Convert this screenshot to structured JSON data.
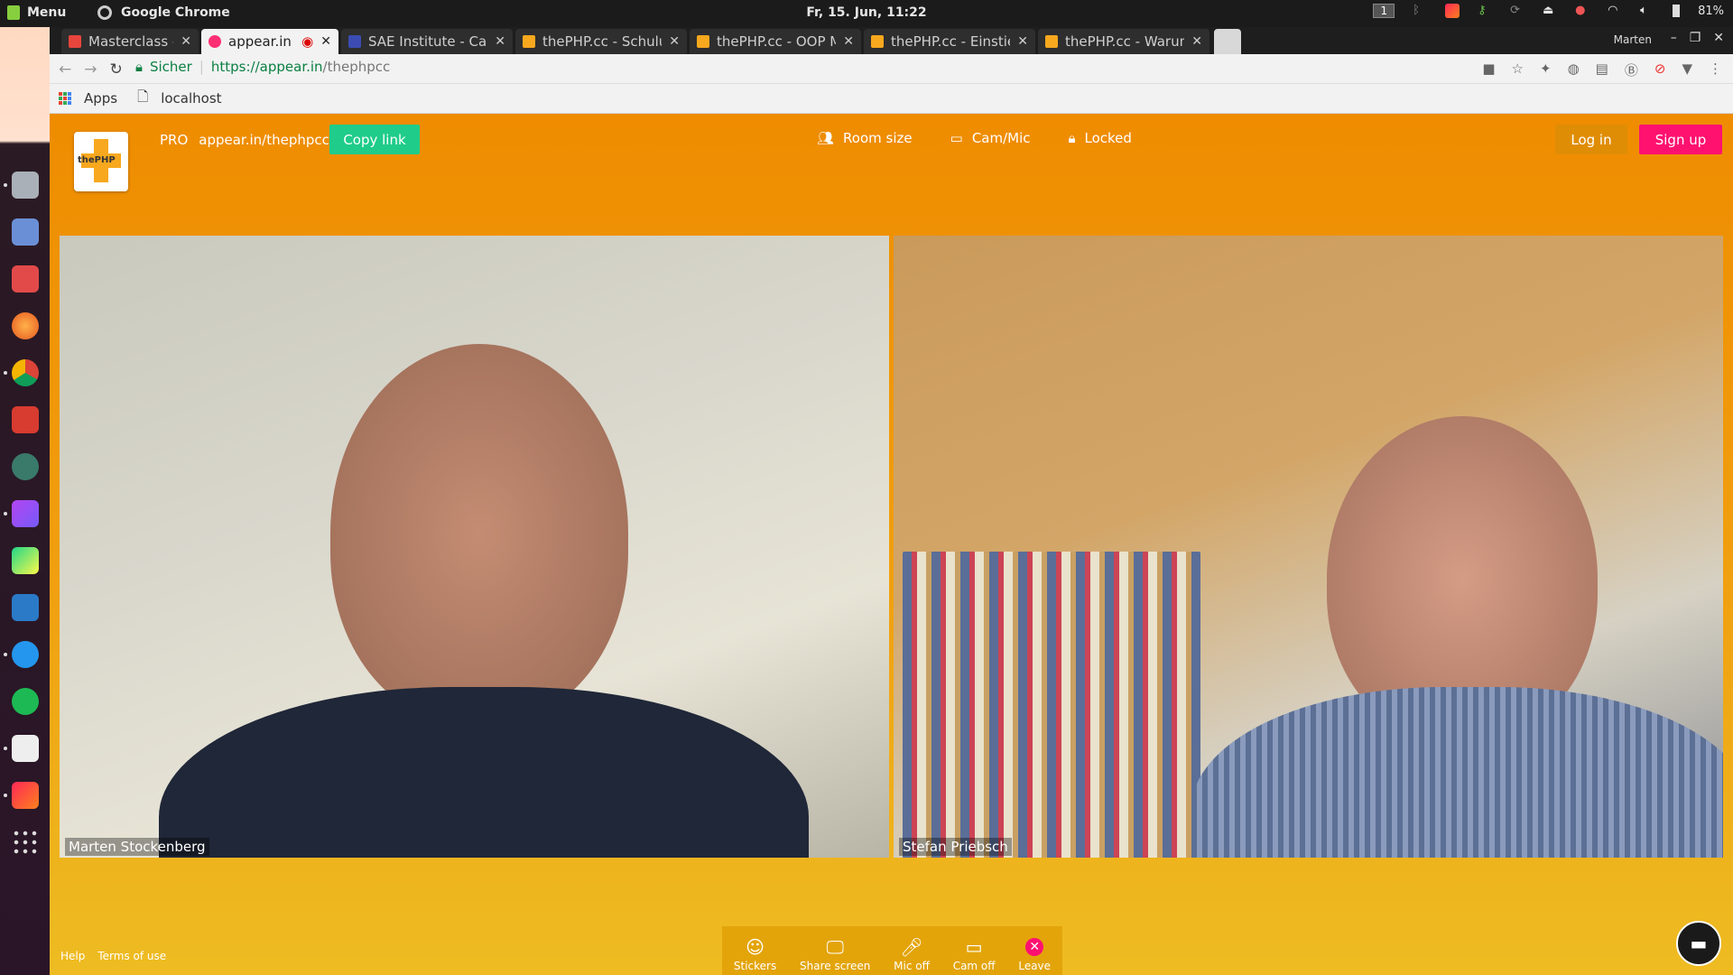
{
  "system": {
    "menu_label": "Menu",
    "app_name": "Google Chrome",
    "clock": "Fr, 15. Jun, 11:22",
    "workspace": "1",
    "battery": "81%"
  },
  "browser": {
    "tabs": [
      {
        "title": "Masterclass - m.sto",
        "color": "#e8453c"
      },
      {
        "title": "appear.in – one",
        "color": "#ff2f74"
      },
      {
        "title": "SAE Institute - Cale",
        "color": "#3b4cb3"
      },
      {
        "title": "thePHP.cc - Schulu",
        "color": "#f7a81e"
      },
      {
        "title": "thePHP.cc - OOP M",
        "color": "#f7a81e"
      },
      {
        "title": "thePHP.cc - Einstie",
        "color": "#f7a81e"
      },
      {
        "title": "thePHP.cc - Warum",
        "color": "#f7a81e"
      }
    ],
    "user": "Marten",
    "secure_label": "Sicher",
    "url_host": "https://appear.in",
    "url_path": "/thephpcc",
    "bookmarks": {
      "apps": "Apps",
      "localhost": "localhost"
    }
  },
  "page": {
    "logo_text": "thePHP",
    "pro_label": "PRO",
    "room_url": "appear.in/thephpcc",
    "copy_link": "Copy link",
    "room_size": "Room size",
    "cam_mic": "Cam/Mic",
    "locked": "Locked",
    "login": "Log in",
    "signup": "Sign up",
    "participants": [
      {
        "name": "Marten Stockenberg"
      },
      {
        "name": "Stefan Priebsch"
      }
    ],
    "footer": {
      "help": "Help",
      "terms": "Terms of use"
    },
    "toolbar": {
      "stickers": "Stickers",
      "share_screen": "Share screen",
      "mic_off": "Mic off",
      "cam_off": "Cam off",
      "leave": "Leave"
    },
    "colors": {
      "accent_green": "#1fcc8a",
      "signup_pink": "#ff1170",
      "page_orange": "#ef8c00"
    }
  }
}
